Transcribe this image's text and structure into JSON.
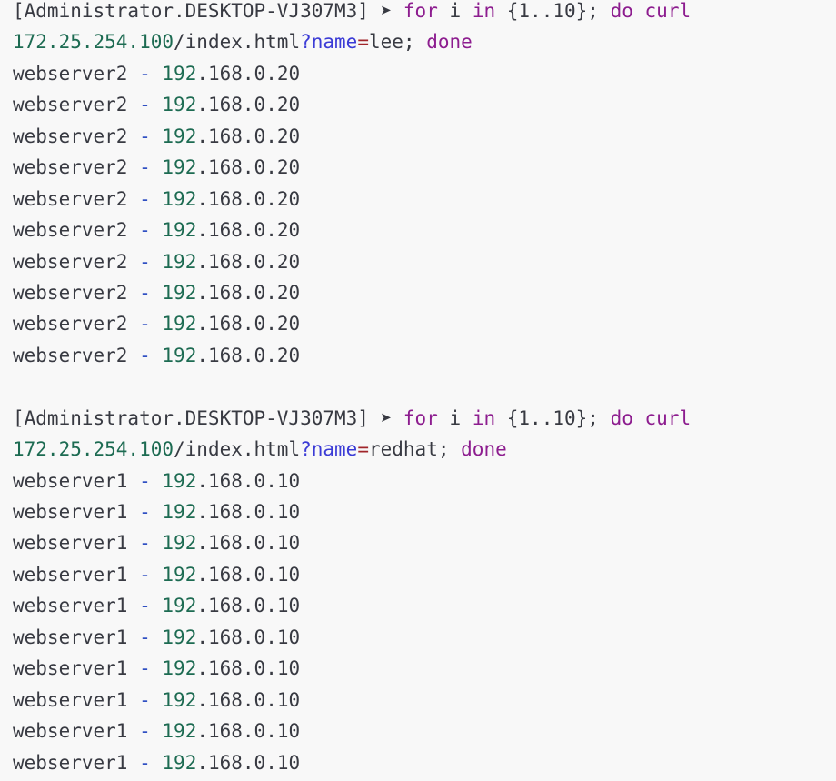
{
  "colors": {
    "background": "#f8f8f8",
    "text": "#383a42",
    "keyword": "#8d1d8f",
    "number": "#1d6b52",
    "operator": "#3b3bd6",
    "equals": "#a0252a"
  },
  "blocks": [
    {
      "prompt": "[Administrator.DESKTOP-VJ307M3]",
      "arrow": "➤",
      "cmd": {
        "for": "for",
        "var": "i",
        "in": "in",
        "range": "{1..10};",
        "do": "do",
        "curl": "curl",
        "url_num": "172.25.254.100",
        "url_path": "/index.html",
        "q": "?",
        "param": "name",
        "eq": "=",
        "value": "lee;",
        "done": "done"
      },
      "host": "webserver2",
      "sep": "-",
      "ip_a": "192",
      "ip_b": ".168.0.20"
    },
    {
      "prompt": "[Administrator.DESKTOP-VJ307M3]",
      "arrow": "➤",
      "cmd": {
        "for": "for",
        "var": "i",
        "in": "in",
        "range": "{1..10};",
        "do": "do",
        "curl": "curl",
        "url_num": "172.25.254.100",
        "url_path": "/index.html",
        "q": "?",
        "param": "name",
        "eq": "=",
        "value": "redhat;",
        "done": "done"
      },
      "host": "webserver1",
      "sep": "-",
      "ip_a": "192",
      "ip_b": ".168.0.10"
    }
  ]
}
